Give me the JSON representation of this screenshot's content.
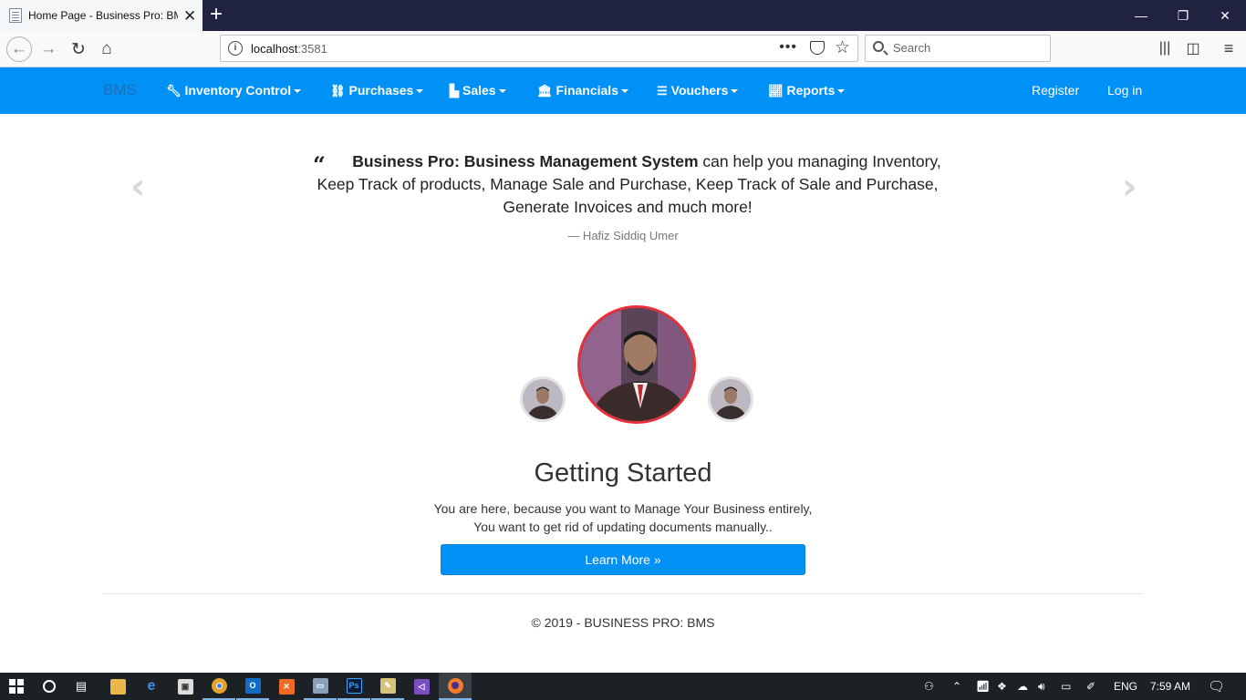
{
  "browser": {
    "tab_title": "Home Page - Business Pro: BMS",
    "url_host": "localhost",
    "url_port": ":3581",
    "search_placeholder": "Search"
  },
  "app": {
    "brand": "BMS",
    "menu": [
      {
        "label": "Inventory Control",
        "icon": "wrench-icon"
      },
      {
        "label": "Purchases",
        "icon": "link-icon"
      },
      {
        "label": "Sales",
        "icon": "industry-icon"
      },
      {
        "label": "Financials",
        "icon": "bank-icon"
      },
      {
        "label": "Vouchers",
        "icon": "database-icon"
      },
      {
        "label": "Reports",
        "icon": "line-chart-icon"
      }
    ],
    "register": "Register",
    "login": "Log in"
  },
  "carousel": {
    "quote_bold": "Business Pro: Business Management System",
    "quote_rest": " can help you managing Inventory, Keep Track of products, Manage Sale and Purchase, Keep Track of Sale and Purchase, Generate Invoices and much more!",
    "author": "— Hafiz Siddiq Umer"
  },
  "hero": {
    "heading": "Getting Started",
    "line1": "You are here, because you want to Manage Your Business entirely,",
    "line2": "You want to get rid of updating documents manually..",
    "button": "Learn More »"
  },
  "footer": {
    "text": "© 2019 - BUSINESS PRO: BMS"
  },
  "taskbar": {
    "language": "ENG",
    "time": "7:59 AM"
  },
  "colors": {
    "header": "#0091f7",
    "avatar_ring": "#e8303a",
    "titlebar": "#202340"
  }
}
